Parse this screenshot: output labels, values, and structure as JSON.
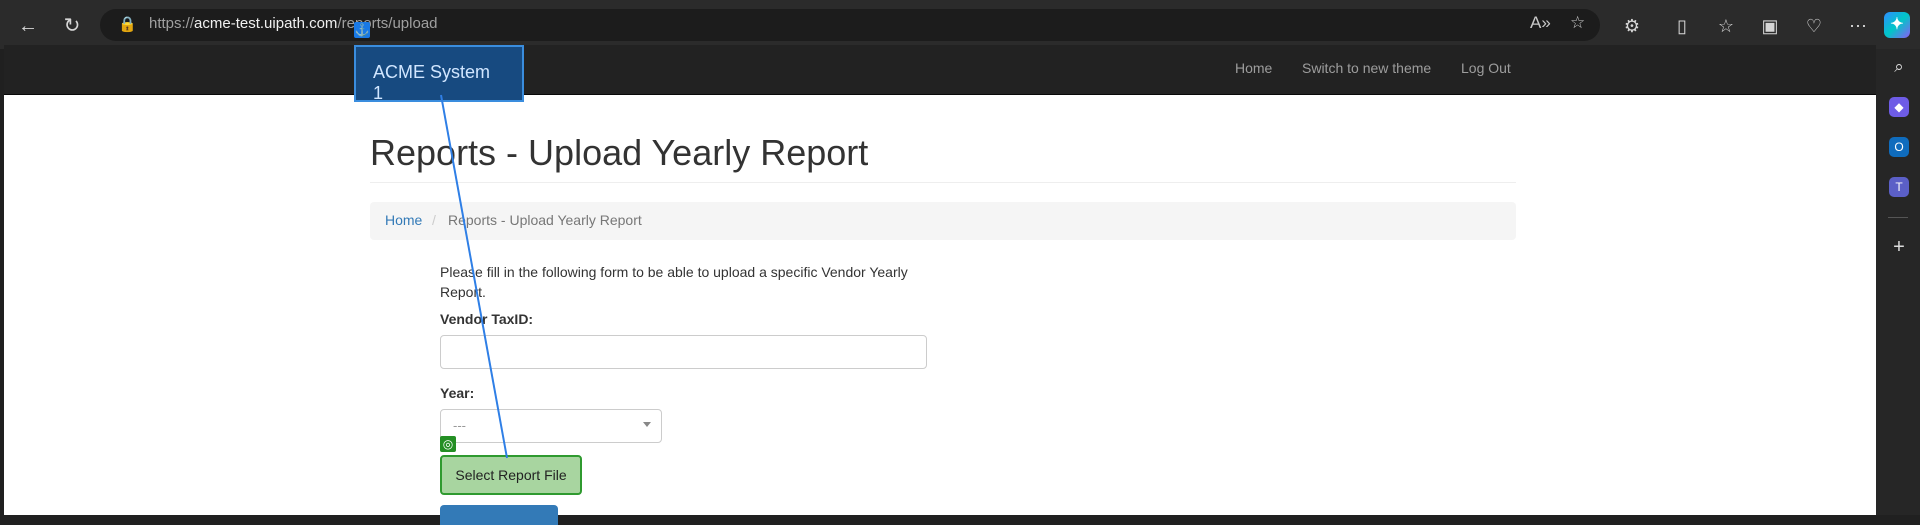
{
  "browser": {
    "url_prefix": "https://",
    "url_host": "acme-test.uipath.com",
    "url_path": "/reports/upload"
  },
  "navbar": {
    "brand": "ACME System 1",
    "links": [
      "Home",
      "Switch to new theme",
      "Log Out"
    ]
  },
  "page": {
    "title": "Reports - Upload Yearly Report",
    "breadcrumb": {
      "home": "Home",
      "separator": "/",
      "current": "Reports - Upload Yearly Report"
    },
    "intro": "Please fill in the following form to be able to upload a specific Vendor Yearly Report.",
    "vendor_label": "Vendor TaxID:",
    "vendor_value": "",
    "year_label": "Year:",
    "year_value": "---",
    "file_button": "Select Report File"
  },
  "colors": {
    "anchor_highlight": "#3a8dde",
    "target_highlight": "#2f9a2f"
  }
}
